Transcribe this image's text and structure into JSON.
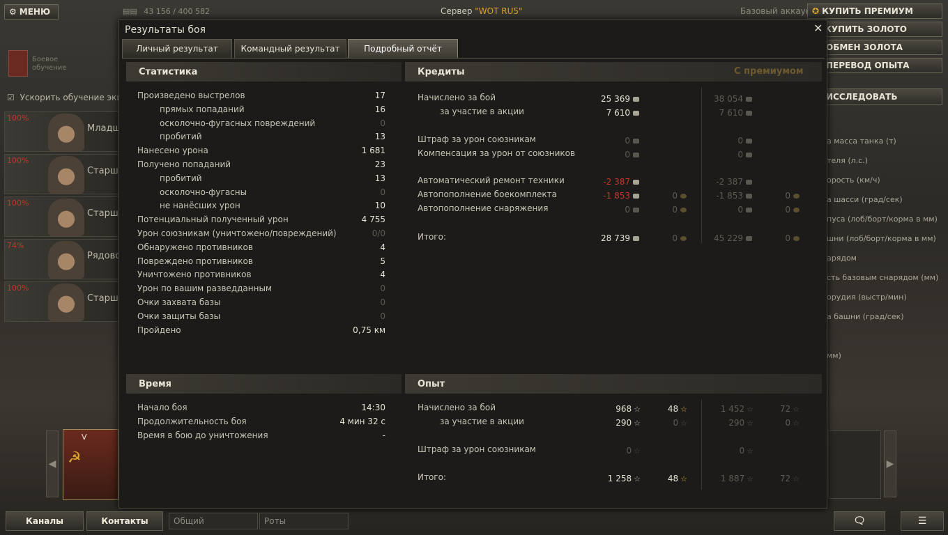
{
  "topbar": {
    "menu": "МЕНЮ",
    "credits_xp": "43 156 / 400 582",
    "server_label": "Сервер",
    "server_name": "\"WOT RU5\"",
    "account": "Базовый аккаунт",
    "buy_premium": "КУПИТЬ ПРЕМИУМ",
    "buy_gold": "КУПИТЬ ЗОЛОТО",
    "exchange_gold": "ОБМЕН ЗОЛОТА",
    "convert_xp": "ПЕРЕВОД ОПЫТА",
    "research": "ИССЛЕДОВАТЬ"
  },
  "left_panel": {
    "training": "Боевое обучение",
    "accelerate": "Ускорить обучение эки"
  },
  "crew": [
    {
      "pct": "100%",
      "rank": "Младш"
    },
    {
      "pct": "100%",
      "rank": "Старши"
    },
    {
      "pct": "100%",
      "rank": "Старши"
    },
    {
      "pct": "74%",
      "rank": "Рядовой"
    },
    {
      "pct": "100%",
      "rank": "Старши"
    }
  ],
  "tank_slot": {
    "tier": "V"
  },
  "right_list": [
    "а масса танка (т)",
    "теля (л.с.)",
    "орость (км/ч)",
    "а шасси (град/сек)",
    "пуса (лоб/борт/корма в мм)",
    "шни (лоб/борт/корма в мм)",
    "арядом",
    "сть базовым снарядом (мм)",
    "орудия (выстр/мин)",
    "а башни (град/сек)",
    "мм)"
  ],
  "dialog": {
    "title": "Результаты боя",
    "tabs": [
      "Личный результат",
      "Командный результат",
      "Подробный отчёт"
    ],
    "stats": {
      "header": "Статистика",
      "rows": [
        {
          "label": "Произведено выстрелов",
          "value": "17",
          "indent": false,
          "dim": false
        },
        {
          "label": "прямых попаданий",
          "value": "16",
          "indent": true,
          "dim": false
        },
        {
          "label": "осколочно-фугасных повреждений",
          "value": "0",
          "indent": true,
          "dim": true
        },
        {
          "label": "пробитий",
          "value": "13",
          "indent": true,
          "dim": false
        },
        {
          "label": "Нанесено урона",
          "value": "1 681",
          "indent": false,
          "dim": false
        },
        {
          "label": "Получено попаданий",
          "value": "23",
          "indent": false,
          "dim": false
        },
        {
          "label": "пробитий",
          "value": "13",
          "indent": true,
          "dim": false
        },
        {
          "label": "осколочно-фугасны",
          "value": "0",
          "indent": true,
          "dim": true
        },
        {
          "label": "не нанёсших урон",
          "value": "10",
          "indent": true,
          "dim": false
        },
        {
          "label": "Потенциальный полученный урон",
          "value": "4 755",
          "indent": false,
          "dim": false
        },
        {
          "label": "Урон союзникам (уничтожено/повреждений)",
          "value": "0/0",
          "indent": false,
          "dim": true
        },
        {
          "label": "Обнаружено противников",
          "value": "4",
          "indent": false,
          "dim": false
        },
        {
          "label": "Повреждено противников",
          "value": "5",
          "indent": false,
          "dim": false
        },
        {
          "label": "Уничтожено противников",
          "value": "4",
          "indent": false,
          "dim": false
        },
        {
          "label": "Урон по вашим разведданным",
          "value": "0",
          "indent": false,
          "dim": true
        },
        {
          "label": "Очки захвата базы",
          "value": "0",
          "indent": false,
          "dim": true
        },
        {
          "label": "Очки защиты базы",
          "value": "0",
          "indent": false,
          "dim": true
        },
        {
          "label": "Пройдено",
          "value": "0,75 км",
          "indent": false,
          "dim": false
        }
      ]
    },
    "credits": {
      "header": "Кредиты",
      "premium_header": "С премиумом",
      "rows": [
        {
          "label": "Начислено за бой",
          "indent": false,
          "c": "25 369",
          "cd": false,
          "g": "",
          "pc": "38 054",
          "pg": ""
        },
        {
          "label": "за участие в акции",
          "indent": true,
          "c": "7 610",
          "cd": false,
          "g": "",
          "pc": "7 610",
          "pg": ""
        },
        {
          "label": "Штраф за урон союзникам",
          "indent": false,
          "c": "0",
          "cd": true,
          "g": "",
          "pc": "0",
          "pg": ""
        },
        {
          "label": "Компенсация за урон от союзников",
          "indent": false,
          "c": "0",
          "cd": true,
          "g": "",
          "pc": "0",
          "pg": ""
        },
        {
          "label": "Автоматический ремонт техники",
          "indent": false,
          "c": "-2 387",
          "cd": false,
          "red": true,
          "g": "",
          "pc": "-2 387",
          "pg": ""
        },
        {
          "label": "Автопополнение боекомплекта",
          "indent": false,
          "c": "-1 853",
          "cd": false,
          "red": true,
          "g": "0",
          "pc": "-1 853",
          "pg": "0"
        },
        {
          "label": "Автопополнение снаряжения",
          "indent": false,
          "c": "0",
          "cd": true,
          "g": "0",
          "pc": "0",
          "pg": "0"
        },
        {
          "label": "Итого:",
          "indent": false,
          "c": "28 739",
          "cd": false,
          "g": "0",
          "pc": "45 229",
          "pg": "0"
        }
      ]
    },
    "time": {
      "header": "Время",
      "rows": [
        {
          "label": "Начало боя",
          "value": "14:30"
        },
        {
          "label": "Продолжительность боя",
          "value": "4 мин 32 с"
        },
        {
          "label": "Время в бою до уничтожения",
          "value": "-"
        }
      ]
    },
    "xp": {
      "header": "Опыт",
      "rows": [
        {
          "label": "Начислено за бой",
          "indent": false,
          "x": "968",
          "xd": false,
          "f": "48",
          "fd": false,
          "px": "1 452",
          "pf": "72"
        },
        {
          "label": "за участие в акции",
          "indent": true,
          "x": "290",
          "xd": false,
          "f": "0",
          "fd": true,
          "px": "290",
          "pf": "0"
        },
        {
          "label": "Штраф за урон союзникам",
          "indent": false,
          "x": "0",
          "xd": true,
          "f": "",
          "fd": true,
          "px": "0",
          "pf": ""
        },
        {
          "label": "Итого:",
          "indent": false,
          "x": "1 258",
          "xd": false,
          "f": "48",
          "fd": false,
          "px": "1 887",
          "pf": "72"
        }
      ]
    }
  },
  "bottombar": {
    "channels": "Каналы",
    "contacts": "Контакты",
    "general_chat": "Общий",
    "companies": "Роты"
  }
}
